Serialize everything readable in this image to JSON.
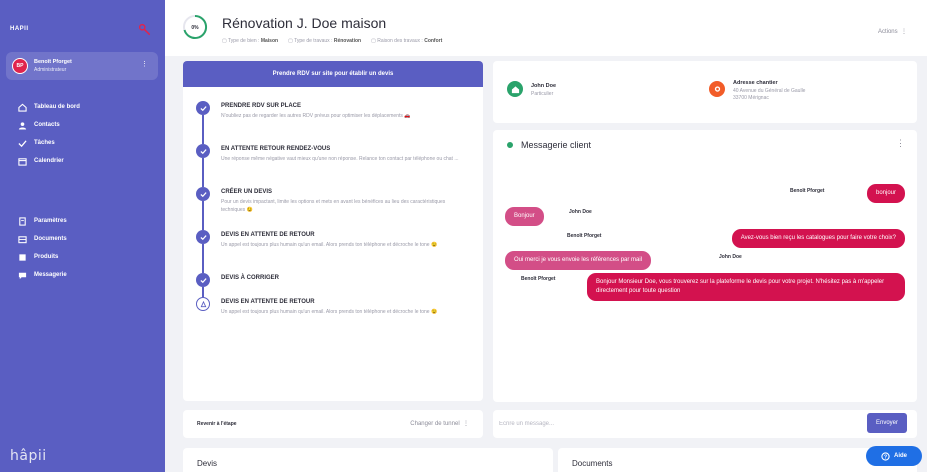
{
  "sidebar": {
    "brand": "HAPII",
    "user": {
      "initials": "BP",
      "name": "Benoît Pforget",
      "role": "Administrateur"
    },
    "items": [
      {
        "label": "Tableau de bord",
        "icon": "home-icon"
      },
      {
        "label": "Contacts",
        "icon": "contacts-icon"
      },
      {
        "label": "Tâches",
        "icon": "tasks-icon"
      },
      {
        "label": "Calendrier",
        "icon": "calendar-icon"
      },
      {
        "label": "Paramètres",
        "icon": "settings-icon"
      },
      {
        "label": "Documents",
        "icon": "documents-icon"
      },
      {
        "label": "Produits",
        "icon": "products-icon"
      },
      {
        "label": "Messagerie",
        "icon": "chat-icon"
      }
    ],
    "logo": "hâpii"
  },
  "header": {
    "progress": "0%",
    "title": "Rénovation J. Doe maison",
    "meta": [
      {
        "label": "Type de bien :",
        "value": "Maison"
      },
      {
        "label": "Type de travaux :",
        "value": "Rénovation"
      },
      {
        "label": "Raison des travaux :",
        "value": "Confort"
      }
    ],
    "actions": "Actions"
  },
  "funnel": {
    "banner": "Prendre RDV sur site pour établir un devis",
    "steps": [
      {
        "title": "PRENDRE RDV SUR PLACE",
        "desc": "N'oubliez pas de regarder les autres RDV prévus pour optimiser les déplacements 🚗",
        "done": true
      },
      {
        "title": "EN ATTENTE RETOUR RENDEZ-VOUS",
        "desc": "Une réponse même négative vaut mieux qu'une non réponse. Relance ton contact par téléphone ou chat ...",
        "done": true
      },
      {
        "title": "CRÉER UN DEVIS",
        "desc": "Pour un devis impactant, limite les options et mets en avant les bénéfices au lieu des caractéristiques techniques 😉",
        "done": true
      },
      {
        "title": "DEVIS EN ATTENTE DE RETOUR",
        "desc": "Un appel est toujours plus humain qu'un email. Alors prends ton téléphone et décroche le tone 😉",
        "done": true
      },
      {
        "title": "DEVIS À CORRIGER",
        "desc": "",
        "done": true
      },
      {
        "title": "DEVIS EN ATTENTE DE RETOUR",
        "desc": "Un appel est toujours plus humain qu'un email. Alors prends ton téléphone et décroche le tone 😉",
        "done": false
      }
    ],
    "back": "Revenir à l'étape",
    "change": "Changer de tunnel"
  },
  "contacts": {
    "client": {
      "name": "John Doe",
      "type": "Particulier"
    },
    "site": {
      "title": "Adresse chantier",
      "line1": "40 Avenue du Général de Gaulle",
      "line2": "33700 Mérignac"
    }
  },
  "chat": {
    "title": "Messagerie client",
    "messages": [
      {
        "sender": "Benoît Pforget",
        "text": "bonjour"
      },
      {
        "sender": "John Doe",
        "text": "Bonjour"
      },
      {
        "sender": "Benoît Pforget",
        "text": "Avez-vous bien reçu les catalogues pour faire votre choix?"
      },
      {
        "sender": "John Doe",
        "text": "Oui merci je vous envoie les références par mail"
      },
      {
        "sender": "Benoît Pforget",
        "text": "Bonjour Monsieur Doe, vous trouverez sur la plateforme le devis pour votre projet. N'hésitez pas à m'appeler directement pour toute question"
      }
    ],
    "placeholder": "Écrire un message...",
    "send": "Envoyer"
  },
  "bottom": {
    "devis": "Devis",
    "documents": "Documents"
  },
  "help": "Aide",
  "colors": {
    "sidebar": "#5a5ec2",
    "accent": "#d3124f",
    "success": "#2aa36b",
    "help": "#1f6fe5"
  }
}
